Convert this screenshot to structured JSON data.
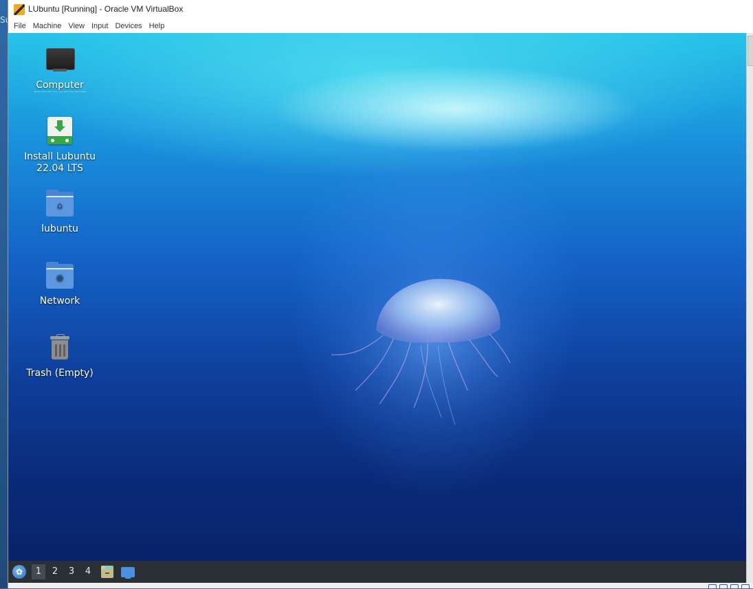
{
  "host": {
    "edge_text": "Su"
  },
  "window": {
    "title": "LUbuntu [Running] - Oracle VM VirtualBox",
    "app_icon": "virtualbox-icon"
  },
  "menu": {
    "items": [
      "File",
      "Machine",
      "View",
      "Input",
      "Devices",
      "Help"
    ]
  },
  "desktop": {
    "icons": [
      {
        "label": "Computer",
        "icon": "computer-icon"
      },
      {
        "label": "Install Lubuntu\n22.04 LTS",
        "icon": "install-icon"
      },
      {
        "label": "lubuntu",
        "icon": "home-folder-icon"
      },
      {
        "label": "Network",
        "icon": "network-folder-icon"
      },
      {
        "label": "Trash (Empty)",
        "icon": "trash-icon"
      }
    ]
  },
  "taskbar": {
    "workspaces": [
      "1",
      "2",
      "3",
      "4"
    ],
    "active_workspace": "1"
  },
  "colors": {
    "taskbar": "#2b2f36",
    "folder": "#4a86cf",
    "install_green": "#3aa64a"
  }
}
